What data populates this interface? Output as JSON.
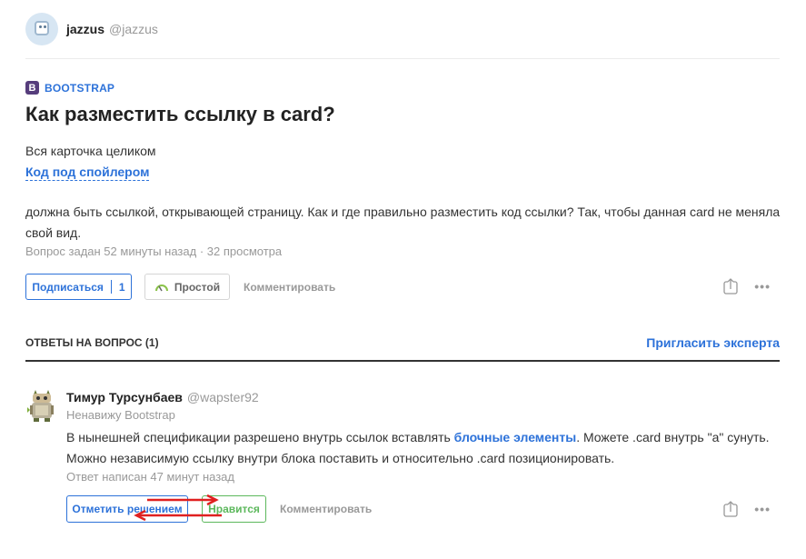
{
  "author": {
    "name": "jazzus",
    "handle": "@jazzus"
  },
  "question": {
    "tag_icon": "B",
    "tag": "BOOTSTRAP",
    "title": "Как разместить ссылку в card?",
    "text1": "Вся карточка целиком",
    "spoiler": "Код под спойлером",
    "text2": "должна быть ссылкой, открывающей страницу. Как и где правильно разместить код ссылки? Так, чтобы данная card не меняла свой вид.",
    "meta": "Вопрос задан 52 минуты назад · 32 просмотра",
    "actions": {
      "subscribe": "Подписаться",
      "subscribe_count": "1",
      "difficulty": "Простой",
      "comment": "Комментировать",
      "more": "•••"
    }
  },
  "answers": {
    "title": "ОТВЕТЫ НА ВОПРОС (1)",
    "invite": "Пригласить эксперта",
    "items": [
      {
        "name": "Тимур Турсунбаев",
        "handle": "@wapster92",
        "subtitle": "Ненавижу Bootstrap",
        "text_before": "В нынешней спецификации разрешено внутрь ссылок вставлять ",
        "text_link": "блочные элементы",
        "text_after": ". Можете .card внутрь \"а\" сунуть. Можно независимую ссылку внутри блока поставить и относительно .card позиционировать.",
        "meta": "Ответ написан 47 минут назад",
        "actions": {
          "solution": "Отметить решением",
          "like": "Нравится",
          "comment": "Комментировать",
          "more": "•••"
        }
      }
    ]
  },
  "colors": {
    "accent": "#2d72d9",
    "bootstrap": "#563d7c",
    "like_green": "#5cb85c",
    "difficulty_gauge": "#8bc34a",
    "annotation_arrow": "#e02020"
  },
  "icons": [
    "user-avatar-icon",
    "bootstrap-tag-icon",
    "difficulty-gauge-icon",
    "share-icon",
    "more-icon"
  ]
}
